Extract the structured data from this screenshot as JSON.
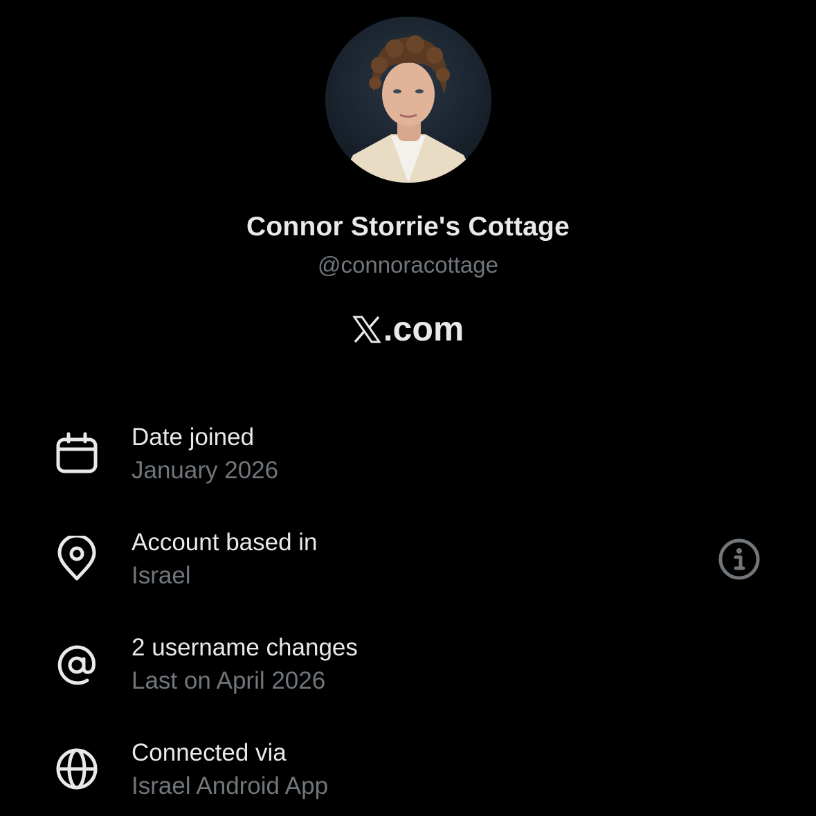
{
  "profile": {
    "display_name": "Connor Storrie's Cottage",
    "handle": "@connoracottage",
    "avatar_icon": "profile-photo-avatar"
  },
  "brand": {
    "suffix": ".com"
  },
  "details": {
    "date_joined": {
      "icon": "calendar-icon",
      "label": "Date joined",
      "value": "January 2026"
    },
    "account_based": {
      "icon": "location-pin-icon",
      "label": "Account based in",
      "value": "Israel",
      "info_icon": "info-icon"
    },
    "username_changes": {
      "icon": "at-sign-icon",
      "label": "2 username changes",
      "value": "Last on April 2026"
    },
    "connected_via": {
      "icon": "globe-icon",
      "label": "Connected via",
      "value": "Israel Android App"
    }
  },
  "colors": {
    "background": "#000000",
    "primary_text": "#e7e9ea",
    "secondary_text": "#71767b"
  }
}
